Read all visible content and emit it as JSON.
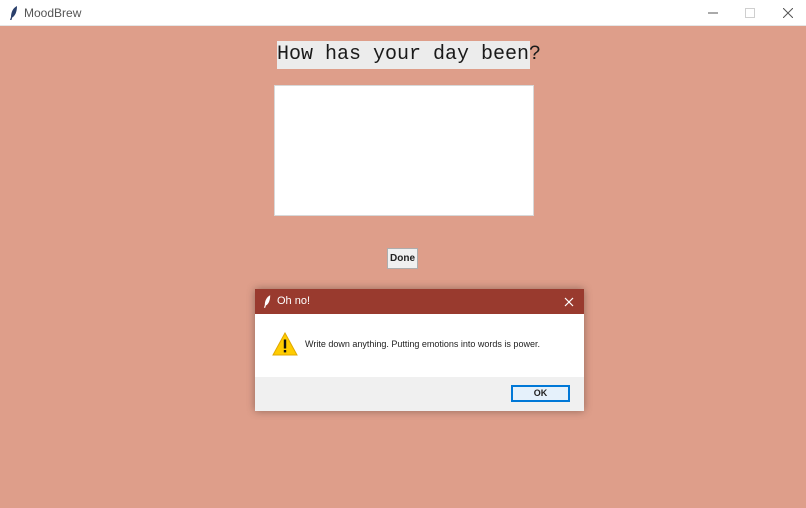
{
  "window": {
    "title": "MoodBrew",
    "controls": {
      "minimize_icon": "minimize-icon",
      "maximize_icon": "maximize-icon",
      "close_icon": "close-icon"
    }
  },
  "main": {
    "prompt": "How has your day been?",
    "entry_value": "",
    "done_label": "Done",
    "background_color": "#DE9E8A"
  },
  "dialog": {
    "title": "Oh no!",
    "message": "Write down anything. Putting emotions into words is power.",
    "ok_label": "OK",
    "icon": "warning-icon",
    "titlebar_color": "#993A2E"
  }
}
